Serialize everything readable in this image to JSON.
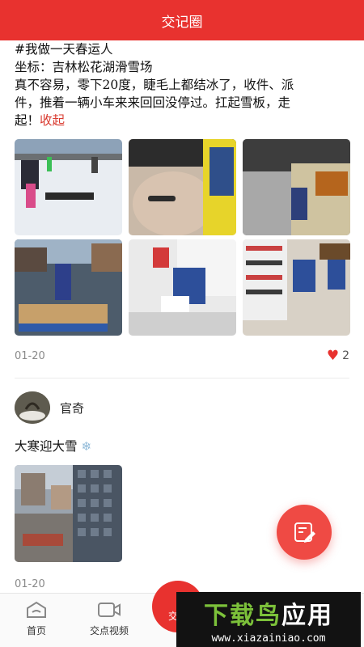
{
  "header": {
    "title": "交记圈"
  },
  "post1": {
    "lines": [
      "#我做一天春运人",
      "坐标：吉林松花湖滑雪场",
      "真不容易，零下20度，睫毛上都结冰了，收件、派",
      "件，推着一辆小车来来回回没停过。扛起雪板，走"
    ],
    "last_line": "起！",
    "collapse_label": "收起",
    "date": "01-20",
    "likes": "2"
  },
  "post2": {
    "author": "官奇",
    "text": "大寒迎大雪",
    "emoji": "❄",
    "date": "01-20"
  },
  "fab": {
    "icon": "edit-icon"
  },
  "tabs": [
    {
      "label": "首页",
      "icon": "home-icon"
    },
    {
      "label": "交点视频",
      "icon": "video-icon"
    },
    {
      "label": "交记",
      "icon": "record-icon"
    }
  ],
  "watermark": {
    "brand_green": "下载鸟",
    "brand_white": "应用",
    "url": "www.xiazainiao.com"
  },
  "colors": {
    "accent": "#e8322f",
    "like": "#e8322f",
    "brand_green": "#7cc13a"
  }
}
